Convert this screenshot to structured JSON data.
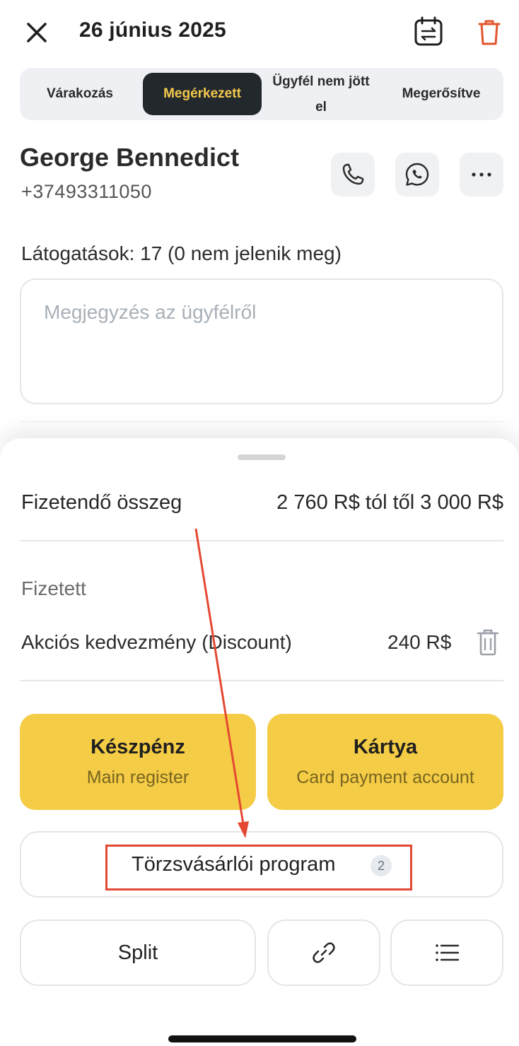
{
  "header": {
    "date_title": "26 június 2025",
    "close_icon": "close-icon",
    "calendar_icon": "calendar-reschedule-icon",
    "trash_icon": "trash-icon",
    "trash_color": "#e2552d"
  },
  "status_tabs": {
    "items": [
      {
        "label": "Várakozás"
      },
      {
        "label": "Megérkezett",
        "selected": true
      },
      {
        "label_line1": "Ügyfél nem jött",
        "label_line2": "el"
      },
      {
        "label": "Megerősítve"
      }
    ],
    "selected_bg": "#23282d",
    "selected_text_color": "#f2c94c"
  },
  "client": {
    "name": "George Bennedict",
    "phone": "+37493311050",
    "actions": [
      "phone-icon",
      "whatsapp-icon",
      "more-icon"
    ]
  },
  "visits_text": "Látogatások: 17 (0 nem jelenik meg)",
  "note": {
    "placeholder": "Megjegyzés az ügyfélről",
    "value": ""
  },
  "payment": {
    "amount_label": "Fizetendő összeg",
    "amount_value": "2 760 R$ tól től 3 000 R$",
    "paid_label": "Fizetett",
    "discount_label": "Akciós kedvezmény (Discount)",
    "discount_value": "240 R$",
    "cash_title": "Készpénz",
    "cash_sub": "Main register",
    "card_title": "Kártya",
    "card_sub": "Card payment account",
    "button_color": "#f5cc45",
    "loyalty_label": "Törzsvásárlói program",
    "loyalty_count": "2",
    "split_label": "Split"
  },
  "annotation": {
    "color": "#e54832"
  }
}
